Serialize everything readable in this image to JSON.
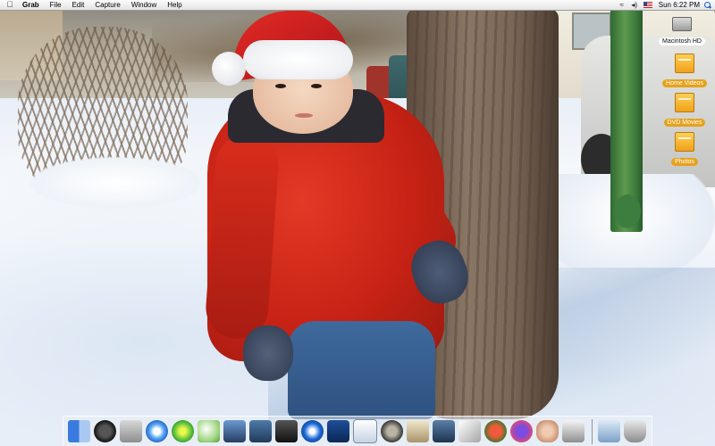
{
  "menubar": {
    "apple_icon": "apple-icon",
    "items": [
      "Grab",
      "File",
      "Edit",
      "Capture",
      "Window",
      "Help"
    ],
    "status_icons": [
      "wifi-icon",
      "volume-icon",
      "flag-icon",
      "spotlight-icon"
    ],
    "clock": "Sun 6:22 PM"
  },
  "desktop": {
    "icons": [
      {
        "label": "Macintosh HD",
        "icon": "hard-drive-icon"
      },
      {
        "label": "Home Videos",
        "icon": "folder-icon"
      },
      {
        "label": "DVD Movies",
        "icon": "folder-icon"
      },
      {
        "label": "Photos",
        "icon": "folder-icon"
      }
    ],
    "label_color": "#e6a21d"
  },
  "dock": {
    "apps": [
      "finder-icon",
      "dashboard-icon",
      "system-preferences-icon",
      "safari-icon",
      "ichat-icon",
      "itunes-icon",
      "iphoto-icon",
      "imovie-icon",
      "photo-booth-icon",
      "dvd-player-icon",
      "keynote-icon",
      "preview-icon",
      "front-row-icon",
      "book-icon",
      "monitor-icon",
      "paper-flyer-icon",
      "tomato-icon",
      "speech-bubble-icon",
      "hand-icon",
      "photo-gallery-icon"
    ],
    "right": [
      "documents-folder-icon",
      "trash-icon"
    ]
  }
}
